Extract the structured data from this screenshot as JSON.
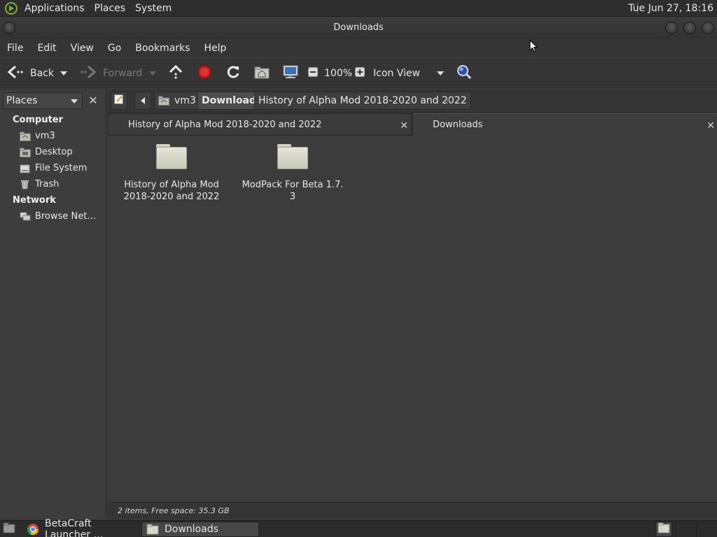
{
  "top_panel": {
    "menus": [
      "Applications",
      "Places",
      "System"
    ],
    "clock": "Tue Jun 27, 18:16"
  },
  "window": {
    "title": "Downloads"
  },
  "menubar": [
    "File",
    "Edit",
    "View",
    "Go",
    "Bookmarks",
    "Help"
  ],
  "toolbar": {
    "back": "Back",
    "forward": "Forward",
    "zoom": "100%",
    "view_mode": "Icon View"
  },
  "sidebar": {
    "selector": "Places",
    "computer_header": "Computer",
    "computer_items": [
      {
        "label": "vm3",
        "icon": "home-folder-icon"
      },
      {
        "label": "Desktop",
        "icon": "desktop-folder-icon"
      },
      {
        "label": "File System",
        "icon": "drive-icon"
      },
      {
        "label": "Trash",
        "icon": "trash-icon"
      }
    ],
    "network_header": "Network",
    "network_items": [
      {
        "label": "Browse Net…",
        "icon": "network-icon"
      }
    ]
  },
  "pathbar": {
    "crumbs": [
      "vm3",
      "Downloads",
      "History of Alpha Mod 2018-2020 and 2022"
    ],
    "active_index": 1
  },
  "tabs": [
    {
      "label": "History of Alpha Mod 2018-2020 and 2022",
      "active": false
    },
    {
      "label": "Downloads",
      "active": true
    }
  ],
  "files": [
    {
      "name_line1": "History of Alpha Mod",
      "name_line2": "2018-2020 and 2022",
      "type": "folder"
    },
    {
      "name_line1": "ModPack For Beta 1.7.",
      "name_line2": "3",
      "type": "folder"
    }
  ],
  "status": "2 items, Free space: 35.3 GB",
  "taskbar": {
    "tasks": [
      {
        "label": "BetaCraft Launcher …",
        "icon": "chrome-icon",
        "active": false
      },
      {
        "label": "Downloads",
        "icon": "folder-icon",
        "active": true
      }
    ]
  },
  "colors": {
    "background": "#3a3a3a",
    "panel": "#2e2e2e",
    "folder": "#d8d8c8",
    "stop": "#cc2222",
    "search": "#4a6fc7"
  }
}
